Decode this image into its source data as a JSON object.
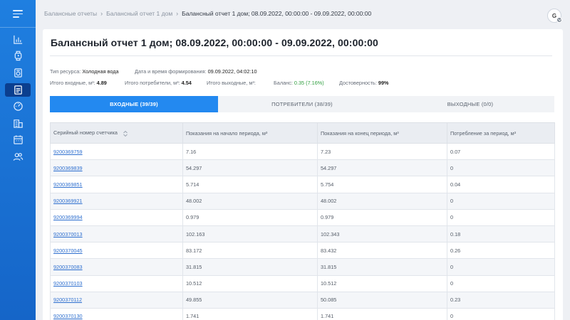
{
  "breadcrumbs": [
    "Балансные отчеты",
    "Балансный отчет 1 дом",
    "Балансный отчет 1 дом; 08.09.2022, 00:00:00 - 09.09.2022, 00:00:00"
  ],
  "user": {
    "initial": "G"
  },
  "sidebar": {
    "icons": [
      "bar-chart-icon",
      "watch-icon",
      "meter-icon",
      "report-icon",
      "gauge-icon",
      "buildings-icon",
      "calendar-icon",
      "users-icon"
    ],
    "active_index": 3
  },
  "report": {
    "title": "Балансный отчет 1 дом; 08.09.2022, 00:00:00 - 09.09.2022, 00:00:00",
    "resource_label": "Тип ресурса:",
    "resource_value": "Холодная вода",
    "generated_label": "Дата и время формирования:",
    "generated_value": "09.09.2022, 04:02:10",
    "total_in_label": "Итого входные, м³:",
    "total_in_value": "4.89",
    "total_consumers_label": "Итого потребители, м³:",
    "total_consumers_value": "4.54",
    "total_out_label": "Итого выходные, м³:",
    "balance_label": "Баланс:",
    "balance_value": "0.35 (7.16%)",
    "reliability_label": "Достоверность:",
    "reliability_value": "99%"
  },
  "tabs": [
    {
      "label": "ВХОДНЫЕ (39/39)",
      "active": true
    },
    {
      "label": "ПОТРЕБИТЕЛИ (38/39)",
      "active": false
    },
    {
      "label": "ВЫХОДНЫЕ (0/0)",
      "active": false
    }
  ],
  "table": {
    "columns": [
      "Серийный номер счетчика",
      "Показания на начало периода, м³",
      "Показания на конец периода, м³",
      "Потребление за период, м³"
    ],
    "rows": [
      [
        "9200369759",
        "7.16",
        "7.23",
        "0.07"
      ],
      [
        "9200369839",
        "54.297",
        "54.297",
        "0"
      ],
      [
        "9200369851",
        "5.714",
        "5.754",
        "0.04"
      ],
      [
        "9200369921",
        "48.002",
        "48.002",
        "0"
      ],
      [
        "9200369994",
        "0.979",
        "0.979",
        "0"
      ],
      [
        "9200370013",
        "102.163",
        "102.343",
        "0.18"
      ],
      [
        "9200370045",
        "83.172",
        "83.432",
        "0.26"
      ],
      [
        "9200370083",
        "31.815",
        "31.815",
        "0"
      ],
      [
        "9200370103",
        "10.512",
        "10.512",
        "0"
      ],
      [
        "9200370112",
        "49.855",
        "50.085",
        "0.23"
      ],
      [
        "9200370130",
        "1.741",
        "1.741",
        "0"
      ]
    ]
  },
  "colors": {
    "sidebar": "#1f7fe0",
    "accent": "#2389f0",
    "balance": "#2e9e3e",
    "link": "#2e6fcf"
  }
}
